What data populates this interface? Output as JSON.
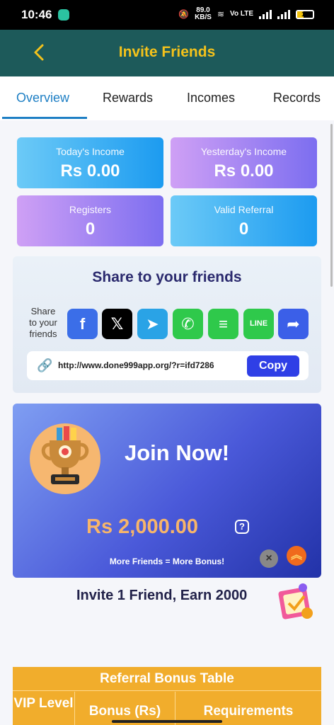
{
  "status_bar": {
    "time": "10:46",
    "net_speed": "89.0",
    "net_speed_unit": "KB/S",
    "volte": "Vo LTE",
    "battery": "19"
  },
  "header": {
    "title": "Invite Friends"
  },
  "tabs": [
    {
      "label": "Overview",
      "active": true
    },
    {
      "label": "Rewards"
    },
    {
      "label": "Incomes"
    },
    {
      "label": "Records"
    }
  ],
  "stats": [
    {
      "label": "Today's Income",
      "value": "Rs 0.00"
    },
    {
      "label": "Yesterday's Income",
      "value": "Rs 0.00"
    },
    {
      "label": "Registers",
      "value": "0"
    },
    {
      "label": "Valid Referral",
      "value": "0"
    }
  ],
  "share": {
    "title": "Share to your friends",
    "label_line1": "Share",
    "label_line2": "to your",
    "label_line3": "friends",
    "icons": [
      {
        "name": "facebook-icon",
        "glyph": "f",
        "color": "#3b6ee8"
      },
      {
        "name": "x-icon",
        "glyph": "𝕏",
        "color": "#000000"
      },
      {
        "name": "telegram-icon",
        "glyph": "➤",
        "color": "#2aa3e6"
      },
      {
        "name": "whatsapp-icon",
        "glyph": "✆",
        "color": "#2fc94b"
      },
      {
        "name": "sms-icon",
        "glyph": "≡",
        "color": "#2fc94b"
      },
      {
        "name": "line-icon",
        "glyph": "LINE",
        "color": "#2fc94b"
      },
      {
        "name": "share-arrow-icon",
        "glyph": "➦",
        "color": "#3b5fe8"
      }
    ],
    "url": "http://www.done999app.org/?r=ifd7286",
    "copy_label": "Copy"
  },
  "promo": {
    "join_label": "Join Now!",
    "amount": "Rs 2,000.00",
    "tagline": "More Friends = More Bonus!"
  },
  "invite_text": "Invite 1 Friend, Earn 2000",
  "bonus_table": {
    "title": "Referral Bonus Table",
    "columns": [
      "VIP Level",
      "Bonus (Rs)",
      "Requirements"
    ]
  },
  "colors": {
    "header_bg": "#1d5a5a",
    "accent_yellow": "#f4c21b",
    "tab_active": "#1e7fc4",
    "copy_button": "#2f3fe6",
    "table_bg": "#f1ad2c"
  }
}
